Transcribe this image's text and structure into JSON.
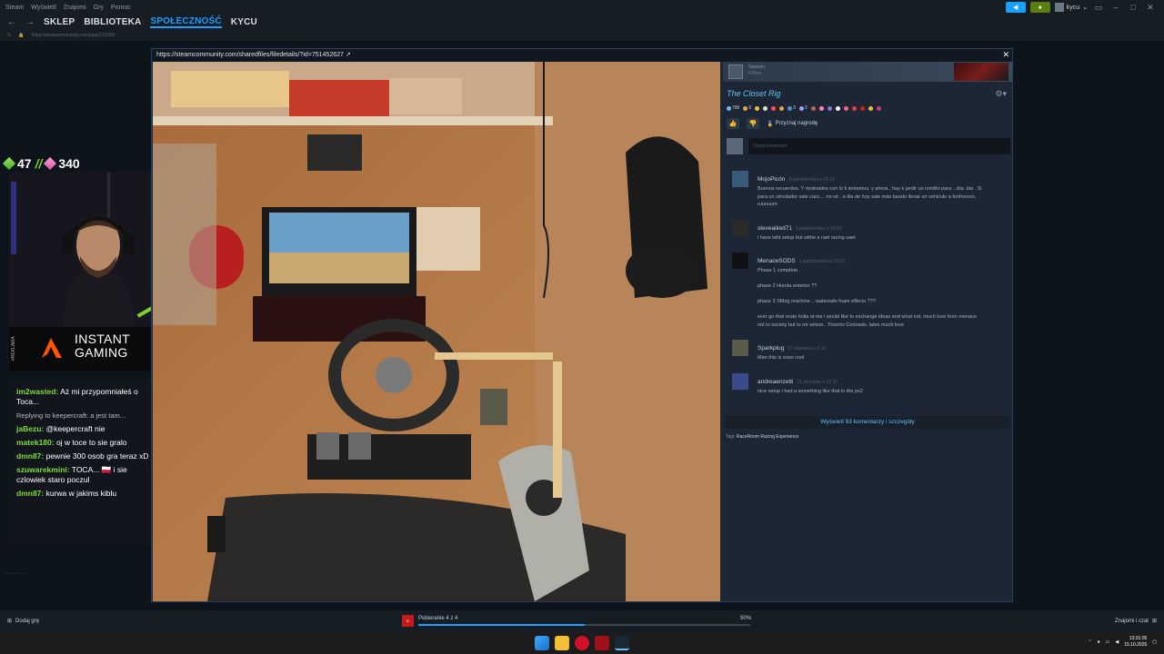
{
  "window": {
    "app_name": "Steam",
    "menu": [
      "Wyświetl",
      "Znajomi",
      "Gry",
      "Pomoc"
    ],
    "user": "kycu"
  },
  "nav": {
    "links": [
      "SKLEP",
      "BIBLIOTEKA",
      "SPOŁECZNOŚĆ",
      "KYCU"
    ],
    "active": "SPOŁECZNOŚĆ",
    "url": "https://steamcommunity.com/app/211500/"
  },
  "modal": {
    "url": "https://steamcommunity.com/sharedfiles/filedetails/?id=751452627",
    "author_name": "Sepssin",
    "author_status": "Offline",
    "title": "The Closet Rig",
    "reactions": [
      {
        "count": "790",
        "color": "#66c0f4"
      },
      {
        "count": "6",
        "color": "#e6a23c"
      },
      {
        "count": "",
        "color": "#f0c040"
      },
      {
        "count": "",
        "color": "#e0e0e0"
      },
      {
        "count": "",
        "color": "#ff5050"
      },
      {
        "count": "",
        "color": "#f0a030"
      },
      {
        "count": "3",
        "color": "#5090e0"
      },
      {
        "count": "2",
        "color": "#a0a0ff"
      },
      {
        "count": "",
        "color": "#c06060"
      },
      {
        "count": "",
        "color": "#ff80c0"
      },
      {
        "count": "",
        "color": "#9070d0"
      },
      {
        "count": "",
        "color": "#ffffff"
      },
      {
        "count": "",
        "color": "#ff6090"
      },
      {
        "count": "",
        "color": "#e04040"
      },
      {
        "count": "",
        "color": "#d02020"
      },
      {
        "count": "",
        "color": "#f0c030"
      },
      {
        "count": "",
        "color": "#c04080"
      }
    ],
    "award_label": "Przyznaj nagrodę",
    "add_comment_placeholder": "Dodaj komentarz",
    "comments": [
      {
        "author": "MojoPicón",
        "time": "8 października o 23:13",
        "text": "Buenos recuerdos. Y motivados con lo k teniamos. y ahora , hay k pedir un crédito para ...bla .bla . Si para un simulador sale caro.... no sé . a dia de hoy sale más barato llevar un vehiculo a fonfooooo, ruuuuum",
        "avatar": "#3a5a7a"
      },
      {
        "author": "stevealiied71",
        "time": "2 października o 23:53",
        "text": "i have taht setup but withe a rael racing saet",
        "avatar": "#2a2a2a"
      },
      {
        "author": "MenaceSODS",
        "time": "1 października o 19:10",
        "text": "Phase 1 complete.\n\nphase 2 Honda enterior ??\n\nphase 3 SMog machine .. watersafe foam effects ???\n\never go that route holla at me i would like to exchange ideas and what not. much love from menace not to society but to mr wilson.. Thornto Colorado. lates much love",
        "avatar": "#111111"
      },
      {
        "author": "Sparkplug",
        "time": "27 września o 5:16",
        "text": "Man this is sooo cool",
        "avatar": "#5a5a4a"
      },
      {
        "author": "andreaenzetti",
        "time": "21 września o 21:16",
        "text": "nice setup i had a something like that in the ps2",
        "avatar": "#3a4a8a"
      }
    ],
    "more_comments": "Wyświetl 93 komentarzy i szczegóły",
    "tags_label": "Tagi:",
    "tags": "RaceRoom Racing Experience"
  },
  "stream": {
    "count_left": "47",
    "separator": "//",
    "count_right": "340",
    "ad_label": "#REKLAMA",
    "ad_line1": "INSTANT",
    "ad_line2": "GAMING",
    "chat": [
      {
        "user": "im2wasted:",
        "text": " Aż mi przypomniałeś o Toca..."
      },
      {
        "reply": "Replying to keepercraft: a jest tam..."
      },
      {
        "user": "jaBezu:",
        "text": " @keepercraft nie"
      },
      {
        "user": "matek180:",
        "text": " oj w toce to sie gralo"
      },
      {
        "user": "dmn87:",
        "text": " pewnie 300 osob gra teraz xD"
      },
      {
        "user": "szuwarekmini:",
        "text": " TOCA... 🇵🇱 i sie czlowiek staro poczul"
      },
      {
        "user": "dmn87:",
        "text": " kurwa w jakims kiblu"
      }
    ]
  },
  "statusbar": {
    "add_game": "Dodaj grę",
    "download_label": "Pobieranie 4 z 4",
    "download_percent": "50%",
    "download_progress": 0.5,
    "friends": "Znajomi i czat"
  },
  "taskbar": {
    "time": "13:31:05",
    "date": "15.10.2025"
  }
}
